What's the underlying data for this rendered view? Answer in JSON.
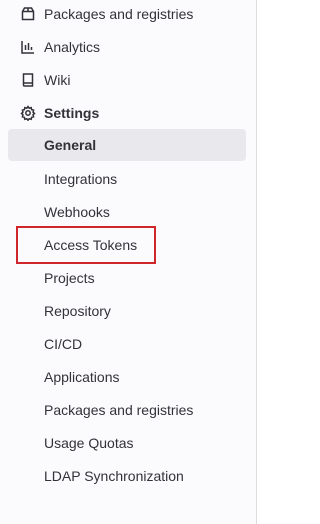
{
  "sidebar": {
    "top_items": [
      {
        "label": "Packages and registries",
        "icon": "package-icon"
      },
      {
        "label": "Analytics",
        "icon": "chart-icon"
      },
      {
        "label": "Wiki",
        "icon": "book-icon"
      }
    ],
    "settings": {
      "label": "Settings",
      "icon": "gear-icon",
      "items": [
        {
          "label": "General",
          "active": true
        },
        {
          "label": "Integrations"
        },
        {
          "label": "Webhooks"
        },
        {
          "label": "Access Tokens",
          "highlighted": true
        },
        {
          "label": "Projects"
        },
        {
          "label": "Repository"
        },
        {
          "label": "CI/CD"
        },
        {
          "label": "Applications"
        },
        {
          "label": "Packages and registries"
        },
        {
          "label": "Usage Quotas"
        },
        {
          "label": "LDAP Synchronization"
        }
      ]
    }
  },
  "colors": {
    "active_bg": "#e9e8ed",
    "highlight_border": "#d0262b",
    "text": "#333238"
  }
}
